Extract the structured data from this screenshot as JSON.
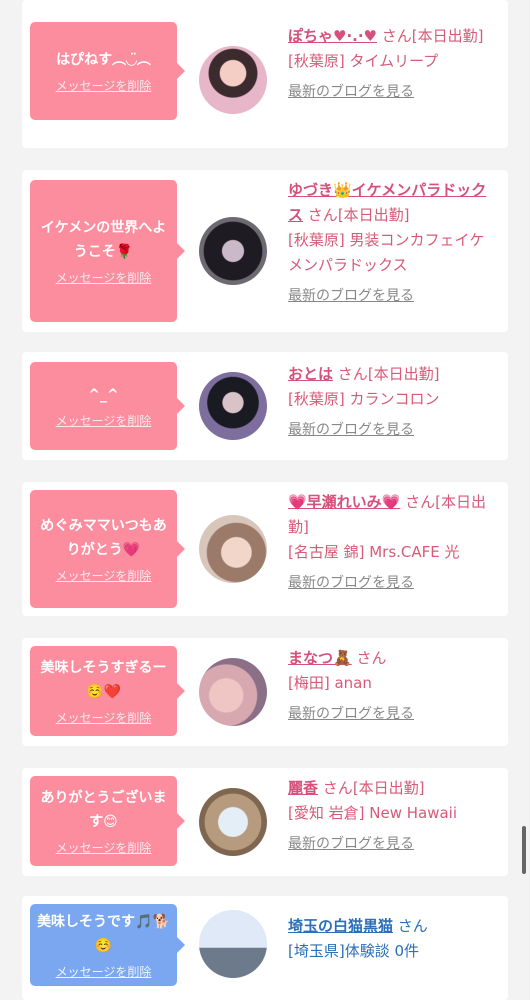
{
  "delete_label": "メッセージを削除",
  "blog_label": "最新のブログを見る",
  "colors": {
    "bubble_pink": "#fb8d9e",
    "bubble_blue": "#7aa7f0",
    "name_pink": "#d5507a",
    "name_blue": "#2a6fb8"
  },
  "cards": [
    {
      "message": "はぴねす︵◡̈︵",
      "name": "ぽちゃ♥·.·♥",
      "san": "さん",
      "status": "[本日出勤]",
      "shop": "[秋葉原] タイムリープ",
      "blog": true,
      "avatar_icon": "profile-photo"
    },
    {
      "message": "イケメンの世界へようこそ🌹",
      "name": "ゆづき👑イケメンパラドックス",
      "san": "さん",
      "status": "[本日出勤]",
      "shop": "[秋葉原] 男装コンカフェイケメンパラドックス",
      "blog": true,
      "avatar_icon": "profile-photo"
    },
    {
      "message": "^_^",
      "name": "おとは",
      "san": "さん",
      "status": "[本日出勤]",
      "shop": "[秋葉原] カランコロン",
      "blog": true,
      "avatar_icon": "profile-photo"
    },
    {
      "message": "めぐみママいつもありがとう💗",
      "name": "💗早瀬れいみ💗",
      "san": "さん",
      "status": "[本日出勤]",
      "shop": "[名古屋 錦] Mrs.CAFE 光",
      "blog": true,
      "avatar_icon": "profile-photo"
    },
    {
      "message": "美味しそうすぎるー☺️❤️",
      "name": "まなつ🧸",
      "san": "さん",
      "status": "",
      "shop": "[梅田] anan",
      "blog": true,
      "avatar_icon": "profile-photo"
    },
    {
      "message": "ありがとうございます😊",
      "name": "麗香",
      "san": "さん",
      "status": "[本日出勤]",
      "shop": "[愛知 岩倉] New Hawaii",
      "blog": true,
      "avatar_icon": "profile-photo"
    },
    {
      "message": "美味しそうです🎵🐕☺️",
      "name": "埼玉の白猫黒猫",
      "san": "さん",
      "status": "",
      "shop": "[埼玉県]体験談 0件",
      "blog": false,
      "avatar_icon": "profile-photo"
    }
  ]
}
